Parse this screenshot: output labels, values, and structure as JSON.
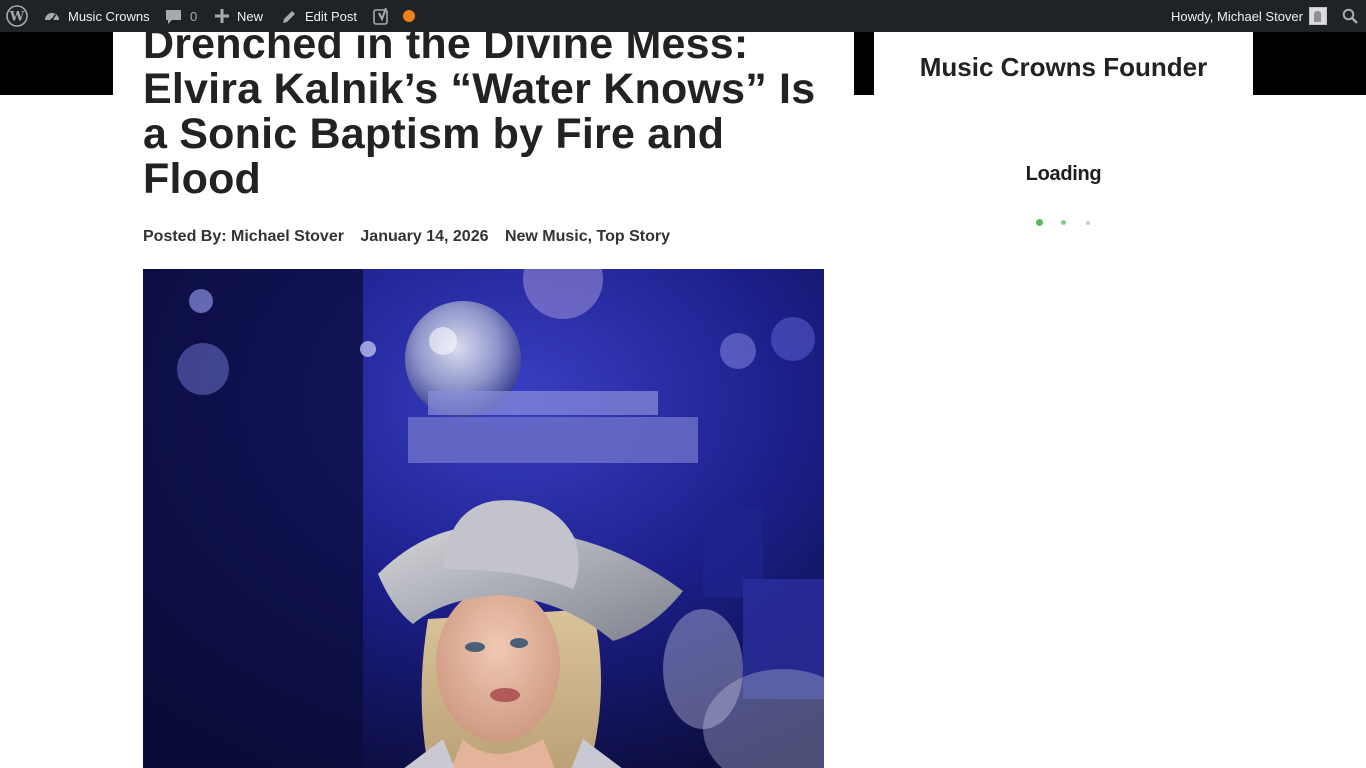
{
  "adminbar": {
    "site_name": "Music Crowns",
    "comments_count": "0",
    "new_label": "New",
    "edit_label": "Edit Post",
    "greeting": "Howdy, Michael Stover",
    "icons": [
      "wordpress-icon",
      "dashboard-icon",
      "comment-icon",
      "plus-icon",
      "pencil-icon",
      "yoast-icon",
      "search-icon"
    ]
  },
  "article": {
    "title": "Drenched in the Divine Mess: Elvira Kalnik’s “Water Knows” Is a Sonic Baptism by Fire and Flood",
    "meta": {
      "author": "Posted By: Michael Stover",
      "date": "January 14, 2026",
      "category_1": "New Music",
      "category_sep": ", ",
      "category_2": "Top Story"
    }
  },
  "sidebar": {
    "widget_title": "Music Crowns Founder",
    "loading": "Loading"
  },
  "colors": {
    "adminbar_bg": "#1d2327",
    "yoast_dot": "#f07e1b",
    "loader_dot": "#5cb85c",
    "header_band": "#000000"
  }
}
